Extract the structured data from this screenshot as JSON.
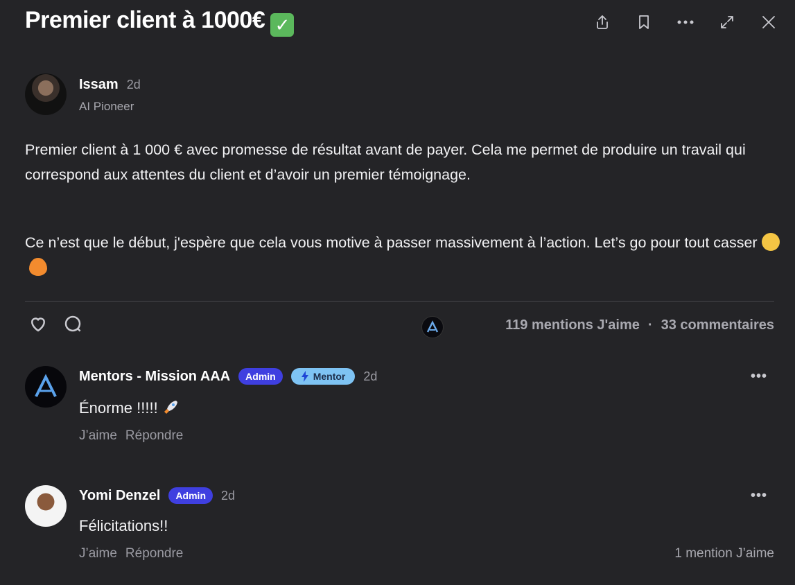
{
  "post": {
    "title": "Premier client à 1000€",
    "title_emoji": "✓",
    "author": {
      "name": "Issam",
      "time": "2d",
      "role": "AI Pioneer"
    },
    "paragraph1": "Premier client à 1 000 € avec promesse de résultat avant de payer. Cela me permet de produire un travail qui correspond aux attentes du client et d’avoir un premier témoignage.",
    "paragraph2": "Ce n’est que le début, j'espère que cela vous motive à passer massivement à l’action. Let’s go pour tout casser",
    "likes_label": "119 mentions J'aime",
    "separator": "·",
    "comments_label": "33 commentaires"
  },
  "toolbar": {
    "icons": [
      "share-icon",
      "bookmark-icon",
      "more-icon",
      "expand-icon",
      "close-icon"
    ]
  },
  "comments": [
    {
      "name": "Mentors - Mission AAA",
      "badges": [
        "Admin",
        "Mentor"
      ],
      "time": "2d",
      "text": "Énorme !!!!!",
      "like": "J’aime",
      "reply": "Répondre",
      "more": "•••"
    },
    {
      "name": "Yomi Denzel",
      "badges": [
        "Admin"
      ],
      "time": "2d",
      "text": "Félicitations!!",
      "like": "J’aime",
      "reply": "Répondre",
      "more": "•••",
      "likes": "1 mention J’aime"
    }
  ],
  "colors": {
    "background": "#242427",
    "admin_badge": "#3f3fe0",
    "mentor_badge": "#7ec3f3"
  }
}
